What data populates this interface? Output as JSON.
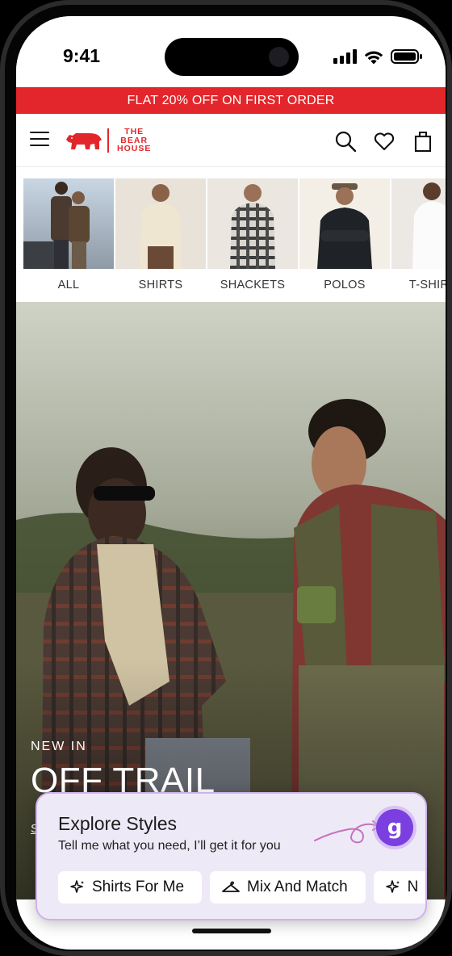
{
  "status_bar": {
    "time": "9:41"
  },
  "promo": {
    "text": "FLAT 20% OFF ON FIRST ORDER"
  },
  "header": {
    "logo_lines": [
      "THE",
      "BEAR",
      "HOUSE"
    ],
    "brand_color": "#e3262b"
  },
  "categories": [
    {
      "label": "ALL"
    },
    {
      "label": "SHIRTS"
    },
    {
      "label": "SHACKETS"
    },
    {
      "label": "POLOS"
    },
    {
      "label": "T-SHIRTS"
    }
  ],
  "hero": {
    "eyebrow": "NEW IN",
    "title": "OFF TRAIL",
    "link": "S"
  },
  "explore": {
    "title": "Explore Styles",
    "subtitle": "Tell me what you need, I’ll get it for you",
    "assistant_glyph": "g",
    "chips": [
      {
        "label": "Shirts For Me",
        "icon": "sparkle-icon"
      },
      {
        "label": "Mix And Match",
        "icon": "hanger-icon"
      },
      {
        "label": "N",
        "icon": "sparkle-icon"
      }
    ],
    "accent": "#7b3fe0"
  }
}
